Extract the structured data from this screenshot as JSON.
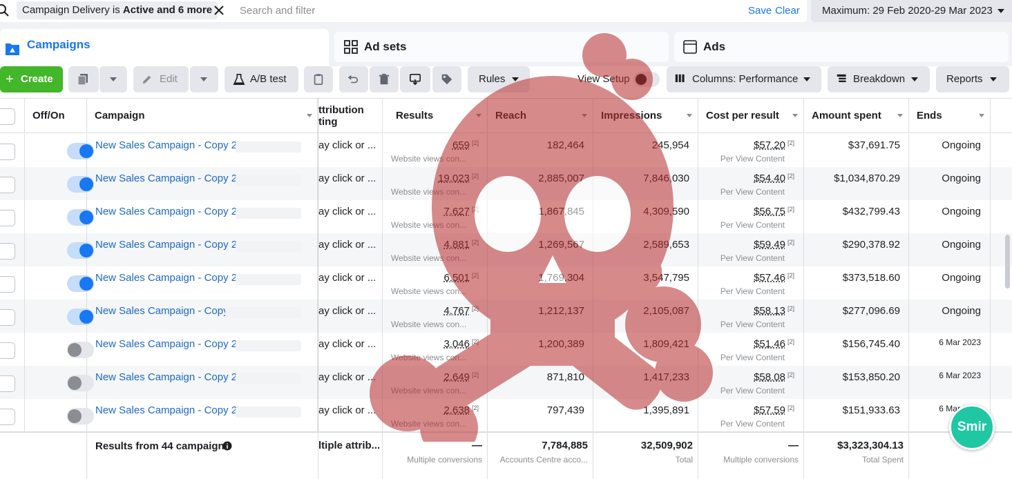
{
  "filter_bar": {
    "chip_prefix": "Campaign Delivery",
    "chip_is": "is",
    "chip_value": "Active and 6 more",
    "placeholder": "Search and filter",
    "save_label": "Save",
    "clear_label": "Clear",
    "date_range": "Maximum: 29 Feb 2020-29 Mar 2023"
  },
  "tabs": {
    "campaigns": "Campaigns",
    "ad_sets": "Ad sets",
    "ads": "Ads"
  },
  "toolbar": {
    "create": "Create",
    "edit": "Edit",
    "ab_test": "A/B test",
    "rules": "Rules",
    "view_setup": "View Setup",
    "columns": "Columns: Performance",
    "breakdown": "Breakdown",
    "reports": "Reports"
  },
  "columns": {
    "off_on": "Off/On",
    "campaign": "Campaign",
    "attribution_line1": "ttribution",
    "attribution_line2": "ting",
    "results": "Results",
    "reach": "Reach",
    "impressions": "Impressions",
    "cost_per_result": "Cost per result",
    "amount_spent": "Amount spent",
    "ends": "Ends"
  },
  "rows": [
    {
      "name": "New Sales Campaign - Copy 2 - ",
      "on": true,
      "attribution": "ay click or ...",
      "results": "659",
      "results_sub": "Website views con...",
      "reach": "182,464",
      "impressions": "245,954",
      "cost": "$57.20",
      "cost_sub": "Per View Content",
      "spent": "$37,691.75",
      "ends": "Ongoing"
    },
    {
      "name": "New Sales Campaign - Copy 2 - ",
      "on": true,
      "attribution": "ay click or ...",
      "results": "19,023",
      "results_sub": "Website views con...",
      "reach": "2,885,007",
      "impressions": "7,846,030",
      "cost": "$54.40",
      "cost_sub": "Per View Content",
      "spent": "$1,034,870.29",
      "ends": "Ongoing"
    },
    {
      "name": "New Sales Campaign - Copy 2 - ",
      "on": true,
      "attribution": "ay click or ...",
      "results": "7,627",
      "results_sub": "Website views con...",
      "reach": "1,867,845",
      "impressions": "4,309,590",
      "cost": "$56.75",
      "cost_sub": "Per View Content",
      "spent": "$432,799.43",
      "ends": "Ongoing"
    },
    {
      "name": "New Sales Campaign - Copy 2 - ",
      "on": true,
      "attribution": "ay click or ...",
      "results": "4,881",
      "results_sub": "Website views con...",
      "reach": "1,269,567",
      "impressions": "2,589,653",
      "cost": "$59.49",
      "cost_sub": "Per View Content",
      "spent": "$290,378.92",
      "ends": "Ongoing"
    },
    {
      "name": "New Sales Campaign - Copy 2 - ",
      "on": true,
      "attribution": "ay click or ...",
      "results": "6,501",
      "results_sub": "Website views con...",
      "reach": "1,769,304",
      "impressions": "3,547,795",
      "cost": "$57.46",
      "cost_sub": "Per View Content",
      "spent": "$373,518.60",
      "ends": "Ongoing"
    },
    {
      "name": "New Sales Campaign - Copy ",
      "on": true,
      "attribution": "ay click or ...",
      "results": "4,767",
      "results_sub": "Website views con...",
      "reach": "1,212,137",
      "impressions": "2,105,087",
      "cost": "$58.13",
      "cost_sub": "Per View Content",
      "spent": "$277,096.69",
      "ends": "Ongoing"
    },
    {
      "name": "New Sales Campaign - Copy 2 - ",
      "on": false,
      "attribution": "ay click or ...",
      "results": "3,046",
      "results_sub": "Website views con...",
      "reach": "1,200,389",
      "impressions": "1,809,421",
      "cost": "$51.46",
      "cost_sub": "Per View Content",
      "spent": "$156,745.40",
      "ends": "6 Mar 2023"
    },
    {
      "name": "New Sales Campaign - Copy 2 - ",
      "on": false,
      "attribution": "ay click or ...",
      "results": "2,649",
      "results_sub": "Website views con...",
      "reach": "871,810",
      "impressions": "1,417,233",
      "cost": "$58.08",
      "cost_sub": "Per View Content",
      "spent": "$153,850.20",
      "ends": "6 Mar 2023"
    },
    {
      "name": "New Sales Campaign - Copy 2 - ",
      "on": false,
      "attribution": "ay click or ...",
      "results": "2,638",
      "results_sub": "Website views con...",
      "reach": "797,439",
      "impressions": "1,395,891",
      "cost": "$57.59",
      "cost_sub": "Per View Content",
      "spent": "$151,933.63",
      "ends": "6 Mar 2023"
    }
  ],
  "footer": {
    "label": "Results from 44 campaigns",
    "attribution": "ltiple attrib...",
    "results": "—",
    "results_sub": "Multiple conversions",
    "reach": "7,784,885",
    "reach_sub": "Accounts Centre acco...",
    "impressions": "32,509,902",
    "impressions_sub": "Total",
    "cost": "—",
    "cost_sub": "Multiple conversions",
    "spent": "$3,323,304.13",
    "spent_sub": "Total Spent"
  },
  "badge": "Smir",
  "colors": {
    "accent": "#1877f2",
    "create": "#42b72a",
    "badge": "#1fc7a3",
    "watermark": "#b82c2c"
  }
}
